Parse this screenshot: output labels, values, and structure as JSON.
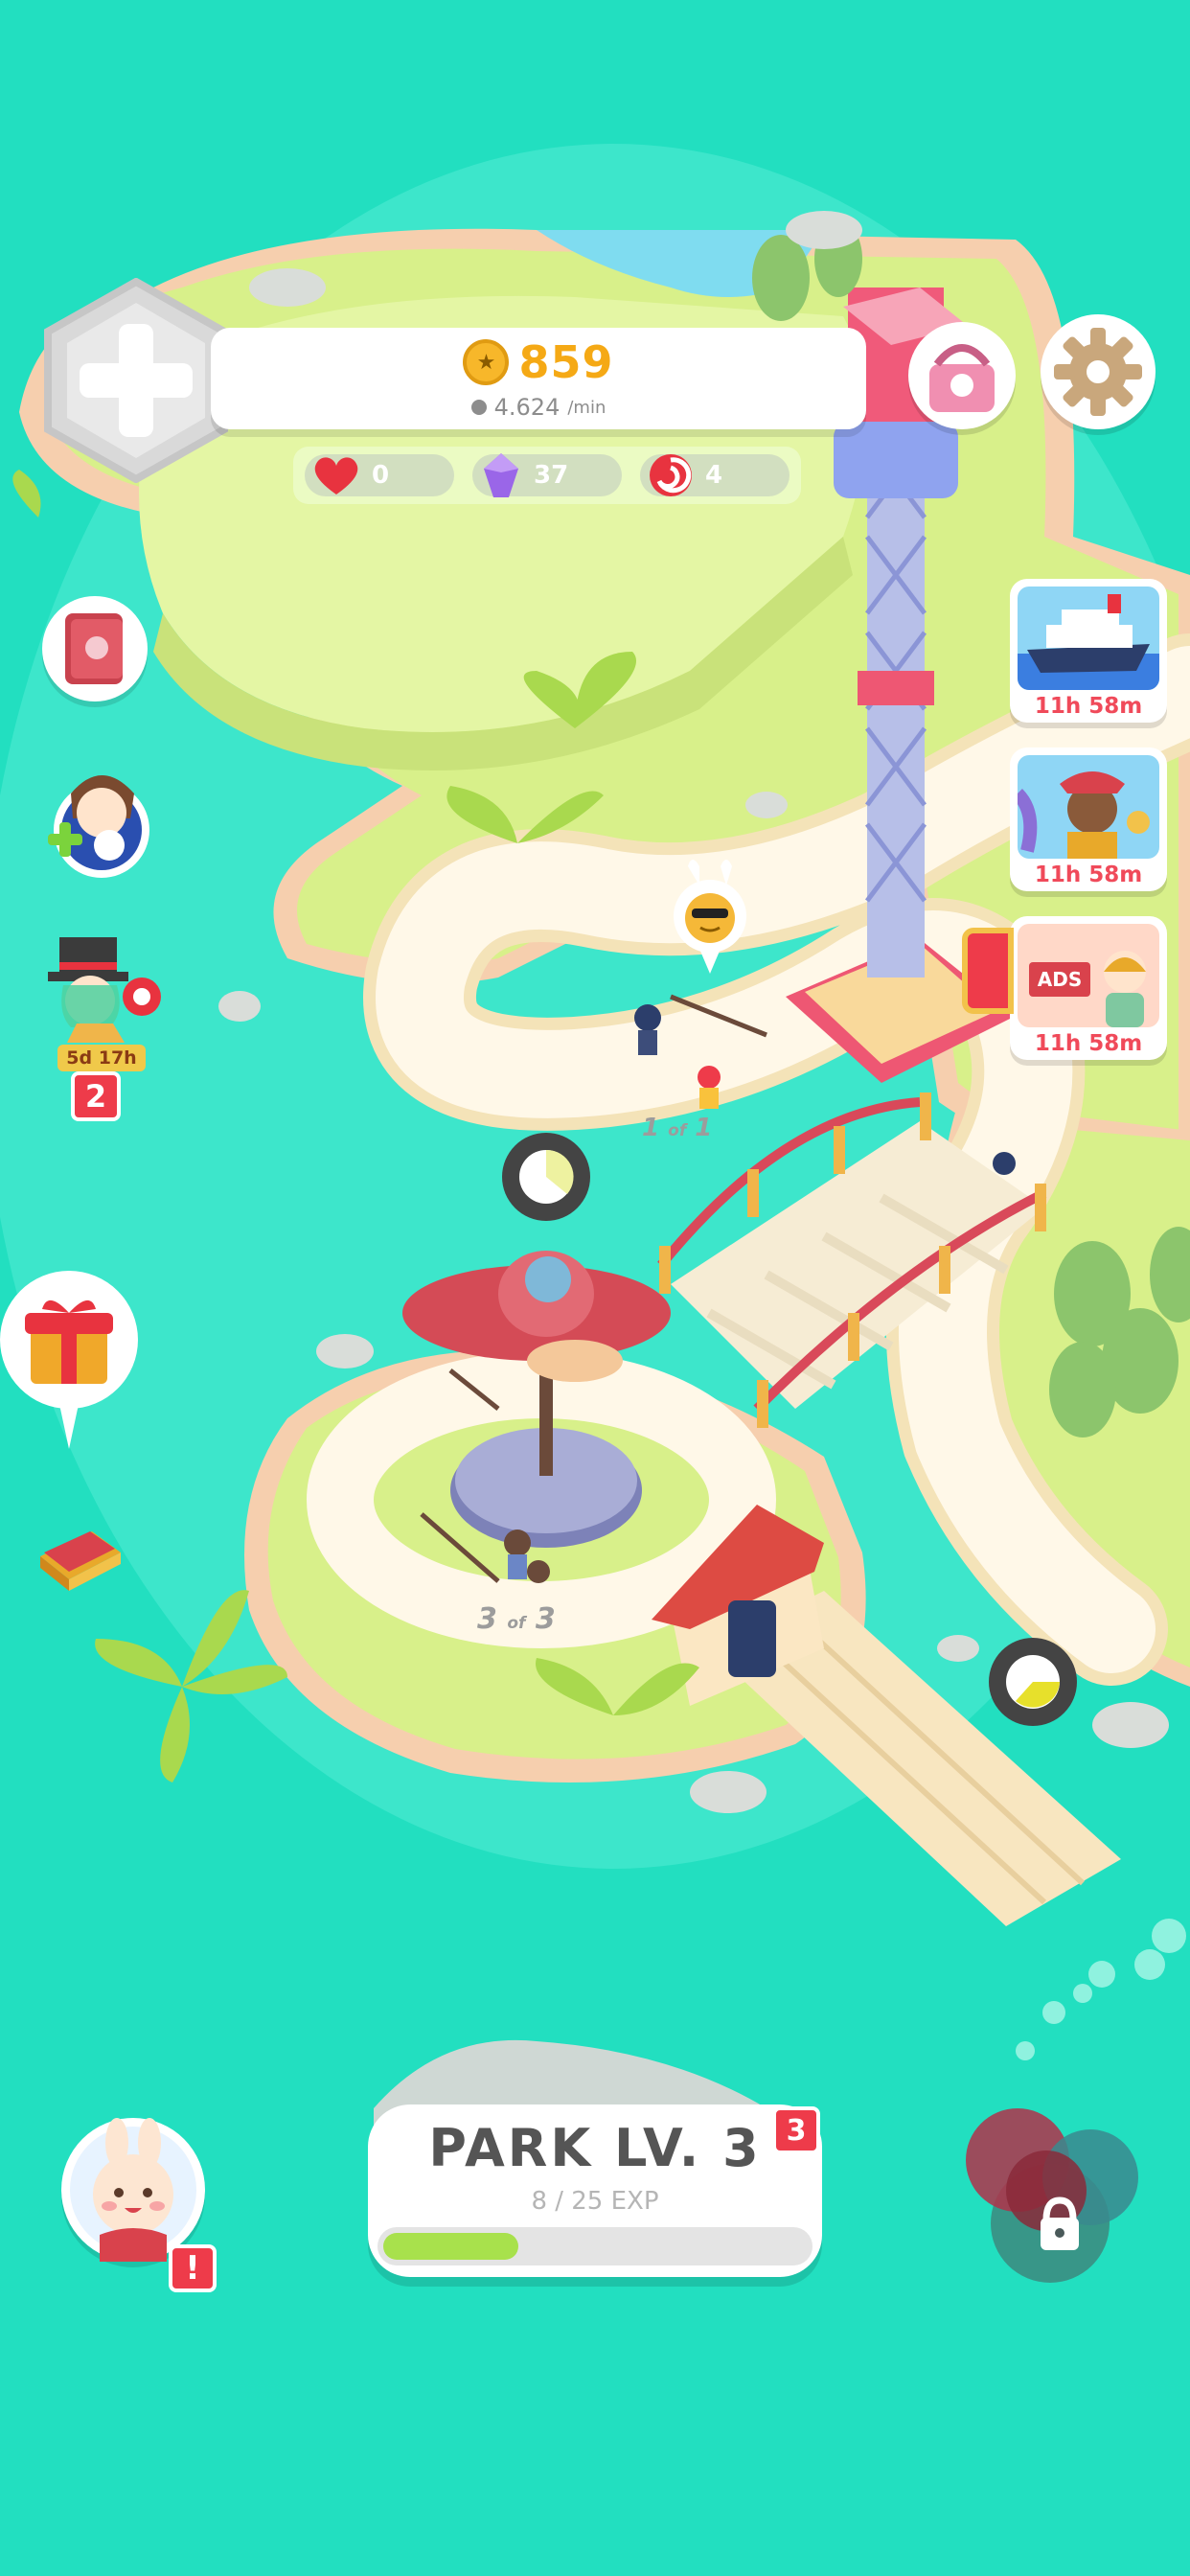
{
  "hud": {
    "coins": "859",
    "coin_rate": "4.624",
    "coin_rate_unit": "/min",
    "hearts": "0",
    "gems": "37",
    "candies": "4"
  },
  "events": [
    {
      "name": "cruise-ship",
      "timer": "11h 58m"
    },
    {
      "name": "pirate",
      "timer": "11h 58m"
    },
    {
      "name": "ads",
      "badge": "ADS",
      "timer": "11h 58m"
    }
  ],
  "left_panel": {
    "magician_timer": "5d 17h",
    "magician_count": "2"
  },
  "map": {
    "ride_label_1": {
      "num": "1",
      "of": "of",
      "total": "1"
    },
    "ride_label_2": {
      "num": "3",
      "of": "of",
      "total": "3"
    }
  },
  "park": {
    "title": "PARK LV. 3",
    "badge": "3",
    "exp_text": "8 / 25 EXP",
    "exp_current": 8,
    "exp_max": 25
  },
  "profile": {
    "alert": "!"
  },
  "colors": {
    "water": "#22dfc0",
    "grass": "#d8f08a",
    "sand": "#f6cfae",
    "path": "#fff8e8",
    "accent_red": "#ee3b4a",
    "coin": "#f5a915",
    "exp_green": "#a8e14c"
  }
}
